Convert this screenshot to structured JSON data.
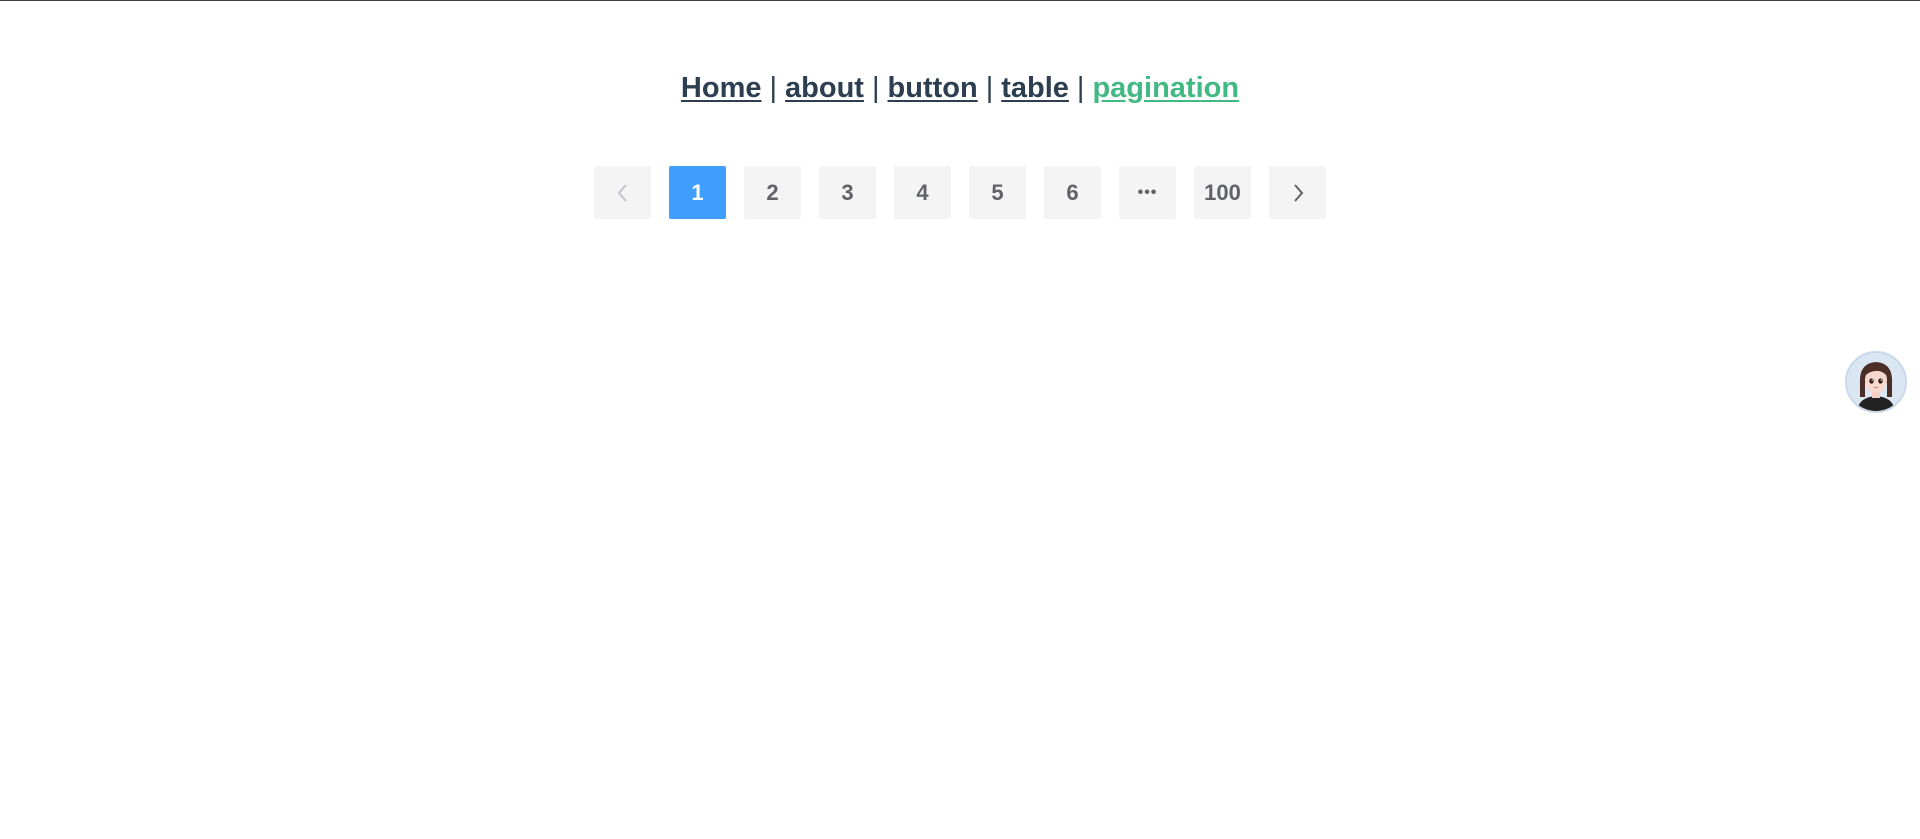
{
  "nav": {
    "links": [
      {
        "label": "Home"
      },
      {
        "label": "about"
      },
      {
        "label": "button"
      },
      {
        "label": "table"
      },
      {
        "label": "pagination",
        "active": true
      }
    ],
    "separator": "|",
    "colors": {
      "link": "#2c3e50",
      "active": "#42b983"
    }
  },
  "pagination": {
    "prev_icon": "chevron-left-icon",
    "next_icon": "chevron-right-icon",
    "pages": [
      "1",
      "2",
      "3",
      "4",
      "5",
      "6"
    ],
    "ellipsis": "•••",
    "last_page": "100",
    "current_page": "1",
    "colors": {
      "active": "#409eff",
      "button_bg": "#f4f4f5",
      "text": "#606266"
    }
  },
  "assistant": {
    "icon": "assistant-avatar-icon"
  }
}
